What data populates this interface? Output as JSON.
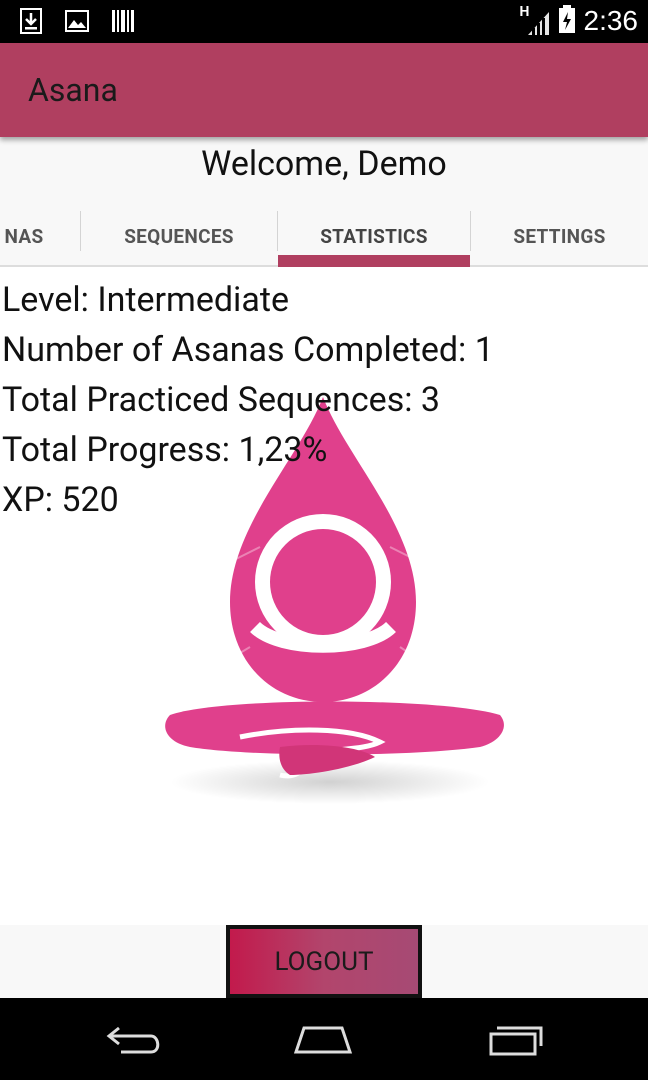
{
  "status_bar": {
    "time": "2:36",
    "network": "H",
    "left_icons": [
      "download-icon",
      "image-icon",
      "barcode-icon"
    ],
    "right_icons": [
      "signal-icon",
      "battery-icon"
    ]
  },
  "app_bar": {
    "title": "Asana"
  },
  "welcome": "Welcome, Demo",
  "tabs": [
    {
      "label": "NAS"
    },
    {
      "label": "SEQUENCES"
    },
    {
      "label": "STATISTICS"
    },
    {
      "label": "SETTINGS"
    }
  ],
  "selected_tab": "STATISTICS",
  "stats": {
    "level": "Level: Intermediate",
    "asanas": "Number of Asanas Completed: 1",
    "sequences": "Total Practiced Sequences: 3",
    "progress": "Total Progress: 1,23%",
    "xp": "XP: 520"
  },
  "logout": {
    "label": "LOGOUT"
  },
  "nav_icons": [
    "back-icon",
    "home-icon",
    "recent-apps-icon"
  ],
  "colors": {
    "primary": "#b03f60",
    "logo": "#e0408c",
    "logout_gradient_start": "#c21a4c",
    "logout_gradient_end": "#a64a74"
  }
}
